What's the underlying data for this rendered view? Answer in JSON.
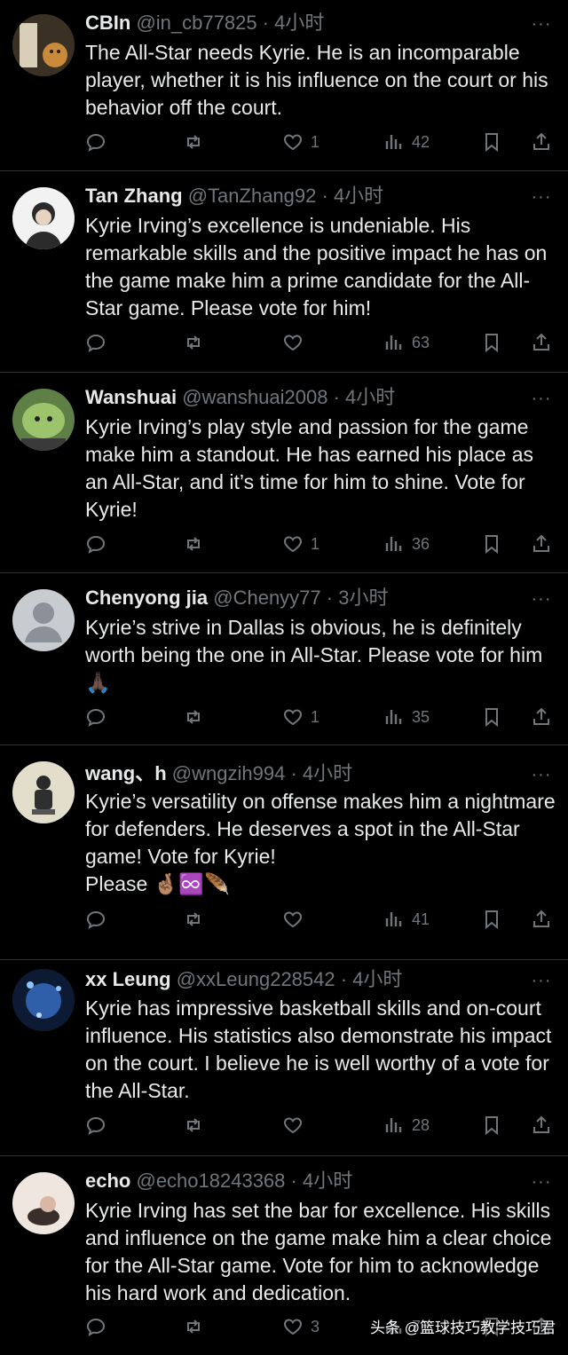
{
  "tweets": [
    {
      "name": "CBIn",
      "handle": "@in_cb77825",
      "sep": " · ",
      "time": "4小时",
      "text": "The All-Star needs Kyrie. He is an incomparable player, whether it is his influence on the court or his behavior off the court.",
      "likes": "1",
      "views": "42",
      "avatar_color": "#6b5a3a"
    },
    {
      "name": "Tan Zhang",
      "handle": "@TanZhang92",
      "sep": " · ",
      "time": "4小时",
      "text": "Kyrie Irving’s excellence is undeniable. His remarkable skills and the positive impact he has on the game make him a prime candidate for the All-Star game. Please vote for him!",
      "likes": "",
      "views": "63",
      "avatar_color": "#e8e8e8"
    },
    {
      "name": "Wanshuai",
      "handle": "@wanshuai2008",
      "sep": " · ",
      "time": "4小时",
      "text": "Kyrie Irving’s play style and passion for the game make him a standout. He has earned his place as an All-Star, and it’s time for him to shine. Vote for Kyrie!",
      "likes": "1",
      "views": "36",
      "avatar_color": "#7fa35a"
    },
    {
      "name": "Chenyong jia",
      "handle": "@Chenyy77",
      "sep": " · ",
      "time": "3小时",
      "text": "Kyrie’s strive in Dallas is obvious, he is definitely worth being the one in All-Star. Please vote for him🙏🏿",
      "likes": "1",
      "views": "35",
      "avatar_color": "#b8c0c8"
    },
    {
      "name": "wang、h",
      "handle": "@wngzih994",
      "sep": " · ",
      "time": "4小时",
      "text": "Kyrie’s versatility on offense makes him a nightmare for defenders. He deserves a spot in the All-Star game! Vote for Kyrie!\nPlease 🤞🏽♾️🪶",
      "likes": "",
      "views": "41",
      "avatar_color": "#d8d2c2"
    },
    {
      "name": "xx Leung",
      "handle": "@xxLeung228542",
      "sep": " · ",
      "time": "4小时",
      "text": "Kyrie has impressive basketball skills and on-court influence. His statistics also demonstrate his impact on the court. I believe he is well worthy of a vote for the All-Star.",
      "likes": "",
      "views": "28",
      "avatar_color": "#1e3a6a"
    },
    {
      "name": "echo",
      "handle": "@echo18243368",
      "sep": " · ",
      "time": "4小时",
      "text": "Kyrie Irving has set the bar for excellence. His skills and influence on the game make him a clear choice for the All-Star game. Vote for him to acknowledge his hard work and dedication.",
      "likes": "3",
      "views": "78",
      "avatar_color": "#e6dcd6"
    }
  ],
  "more_label": "···",
  "icons": [
    "reply-icon",
    "retweet-icon",
    "heart-icon",
    "views-icon",
    "bookmark-icon",
    "share-icon",
    "more-icon"
  ],
  "watermark": "头条 @篮球技巧教学技巧君"
}
